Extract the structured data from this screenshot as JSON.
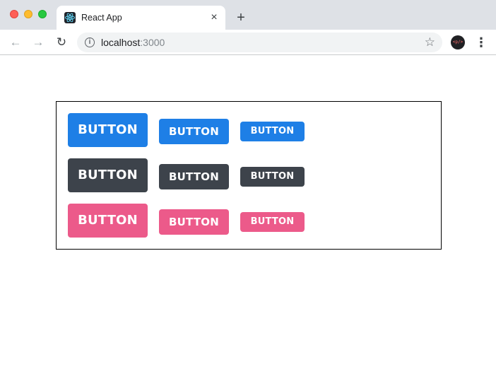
{
  "browser": {
    "tab": {
      "title": "React App",
      "favicon": "react-logo-icon",
      "close": "×"
    },
    "new_tab": "+",
    "nav": {
      "back": "←",
      "forward": "→",
      "reload": "↻"
    },
    "address": {
      "info": "i",
      "host": "localhost",
      "port": ":3000"
    },
    "star": "☆",
    "profile": "<p/>",
    "menu": "⋮"
  },
  "page": {
    "rows": [
      {
        "variant": "primary",
        "color": "#1e7fe6",
        "buttons": [
          "BUTTON",
          "BUTTON",
          "BUTTON"
        ]
      },
      {
        "variant": "dark",
        "color": "#3d434b",
        "buttons": [
          "BUTTON",
          "BUTTON",
          "BUTTON"
        ]
      },
      {
        "variant": "pink",
        "color": "#ec5a8a",
        "buttons": [
          "BUTTON",
          "BUTTON",
          "BUTTON"
        ]
      }
    ],
    "sizes": [
      "large",
      "medium",
      "small"
    ]
  }
}
